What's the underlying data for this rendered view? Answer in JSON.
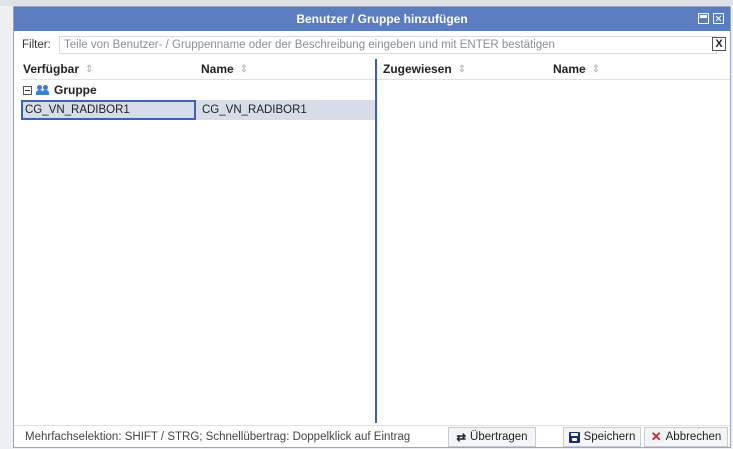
{
  "dialog": {
    "title": "Benutzer / Gruppe hinzufügen"
  },
  "filter": {
    "label": "Filter:",
    "placeholder": "Teile von Benutzer- / Gruppenname oder der Beschreibung eingeben und mit ENTER bestätigen",
    "clear_label": "X"
  },
  "left_pane": {
    "columns": [
      "Verfügbar",
      "Name"
    ],
    "group_label": "Gruppe",
    "rows": [
      {
        "verfuegbar": "CG_VN_RADIBOR1",
        "name": "CG_VN_RADIBOR1"
      }
    ]
  },
  "right_pane": {
    "columns": [
      "Zugewiesen",
      "Name"
    ]
  },
  "footer": {
    "hint": "Mehrfachselektion: SHIFT / STRG; Schnellübertrag: Doppelklick auf Eintrag",
    "transfer_label": "Übertragen",
    "save_label": "Speichern",
    "cancel_label": "Abbrechen"
  },
  "icons": {
    "sort": "sort-icon",
    "group": "users-icon",
    "transfer": "swap-arrows-icon",
    "save": "floppy-disk-icon",
    "cancel": "close-x-icon"
  },
  "colors": {
    "titlebar": "#5b7dbf",
    "selection_border": "#3d63b0",
    "row_highlight": "#d6dde9",
    "cancel_red": "#d32020"
  }
}
